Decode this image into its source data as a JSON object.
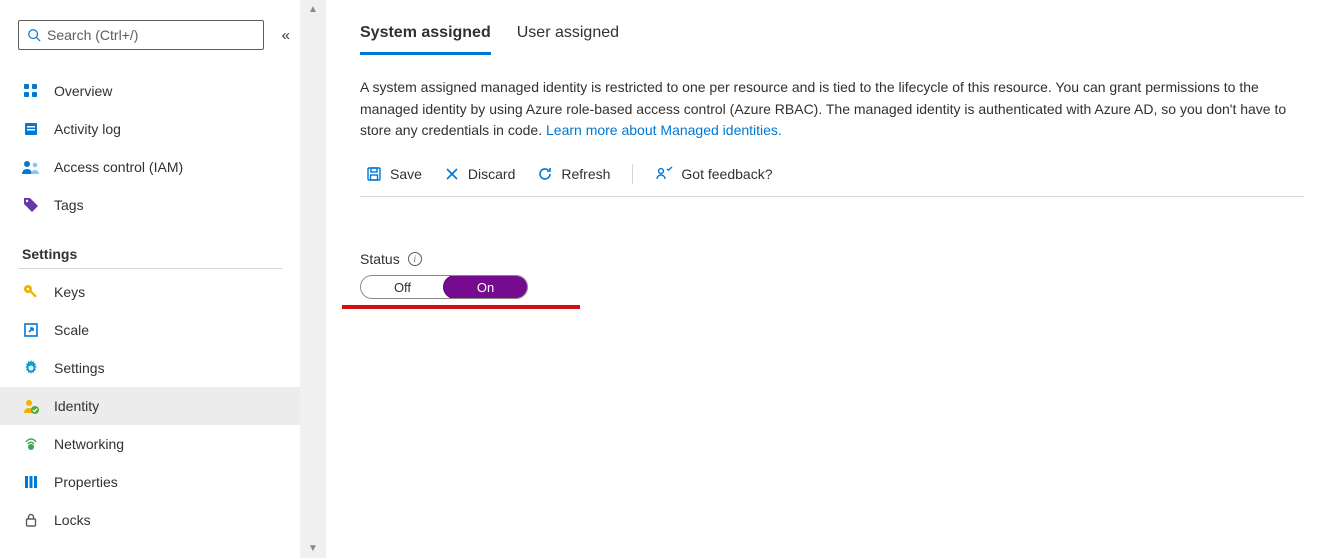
{
  "search": {
    "placeholder": "Search (Ctrl+/)"
  },
  "sidebar": {
    "items_top": [
      {
        "label": "Overview",
        "icon": "overview-icon"
      },
      {
        "label": "Activity log",
        "icon": "activity-log-icon"
      },
      {
        "label": "Access control (IAM)",
        "icon": "access-control-icon"
      },
      {
        "label": "Tags",
        "icon": "tags-icon"
      }
    ],
    "section_header": "Settings",
    "items_settings": [
      {
        "label": "Keys",
        "icon": "keys-icon"
      },
      {
        "label": "Scale",
        "icon": "scale-icon"
      },
      {
        "label": "Settings",
        "icon": "settings-icon"
      },
      {
        "label": "Identity",
        "icon": "identity-icon",
        "selected": true
      },
      {
        "label": "Networking",
        "icon": "networking-icon"
      },
      {
        "label": "Properties",
        "icon": "properties-icon"
      },
      {
        "label": "Locks",
        "icon": "locks-icon"
      }
    ]
  },
  "tabs": {
    "system_assigned": "System assigned",
    "user_assigned": "User assigned"
  },
  "description": {
    "text": "A system assigned managed identity is restricted to one per resource and is tied to the lifecycle of this resource. You can grant permissions to the managed identity by using Azure role-based access control (Azure RBAC). The managed identity is authenticated with Azure AD, so you don't have to store any credentials in code. ",
    "link_text": "Learn more about Managed identities."
  },
  "toolbar": {
    "save": "Save",
    "discard": "Discard",
    "refresh": "Refresh",
    "feedback": "Got feedback?"
  },
  "status": {
    "label": "Status",
    "off": "Off",
    "on": "On"
  }
}
